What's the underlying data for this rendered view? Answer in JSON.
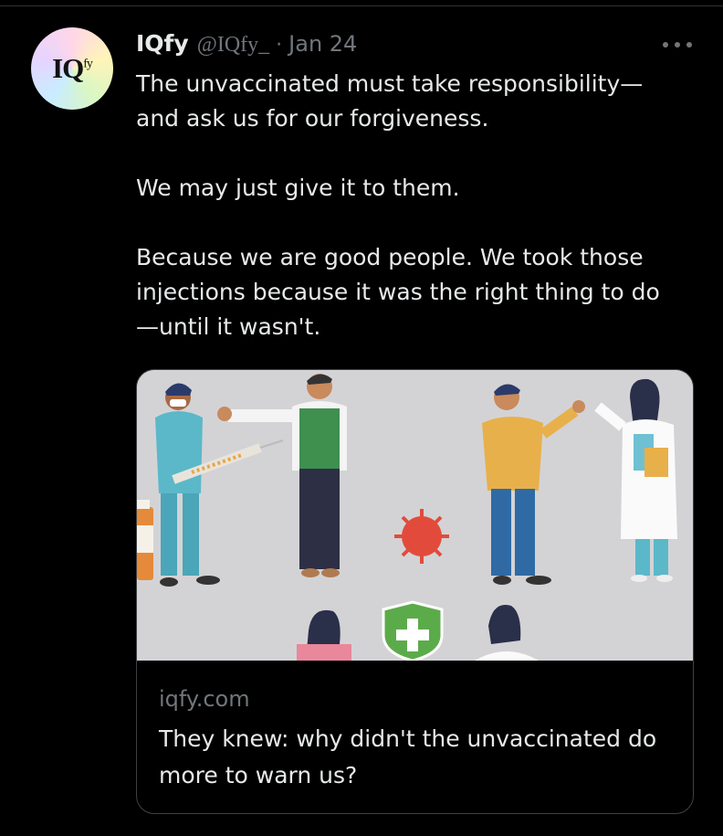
{
  "tweet": {
    "author": {
      "avatar_text": "IQ",
      "avatar_sup": "fy",
      "name": "IQfy",
      "handle": "@IQfy_",
      "separator": "·",
      "date": "Jan 24"
    },
    "text_blocks": [
      "The unvaccinated must take responsibility—\nand ask us for our forgiveness.",
      "We may just give it to them.",
      "Because we are good people. We took those\ninjections because it was the right thing to do\n—until it wasn't."
    ],
    "more_icon": "more-horizontal-icon",
    "card": {
      "domain": "iqfy.com",
      "title": "They knew: why didn't the unvaccinated do more to warn us?",
      "image_background": "#d3d3d6"
    }
  },
  "colors": {
    "background": "#000000",
    "text_primary": "#e7e9ea",
    "text_secondary": "#71767b",
    "border": "#3e4144"
  }
}
